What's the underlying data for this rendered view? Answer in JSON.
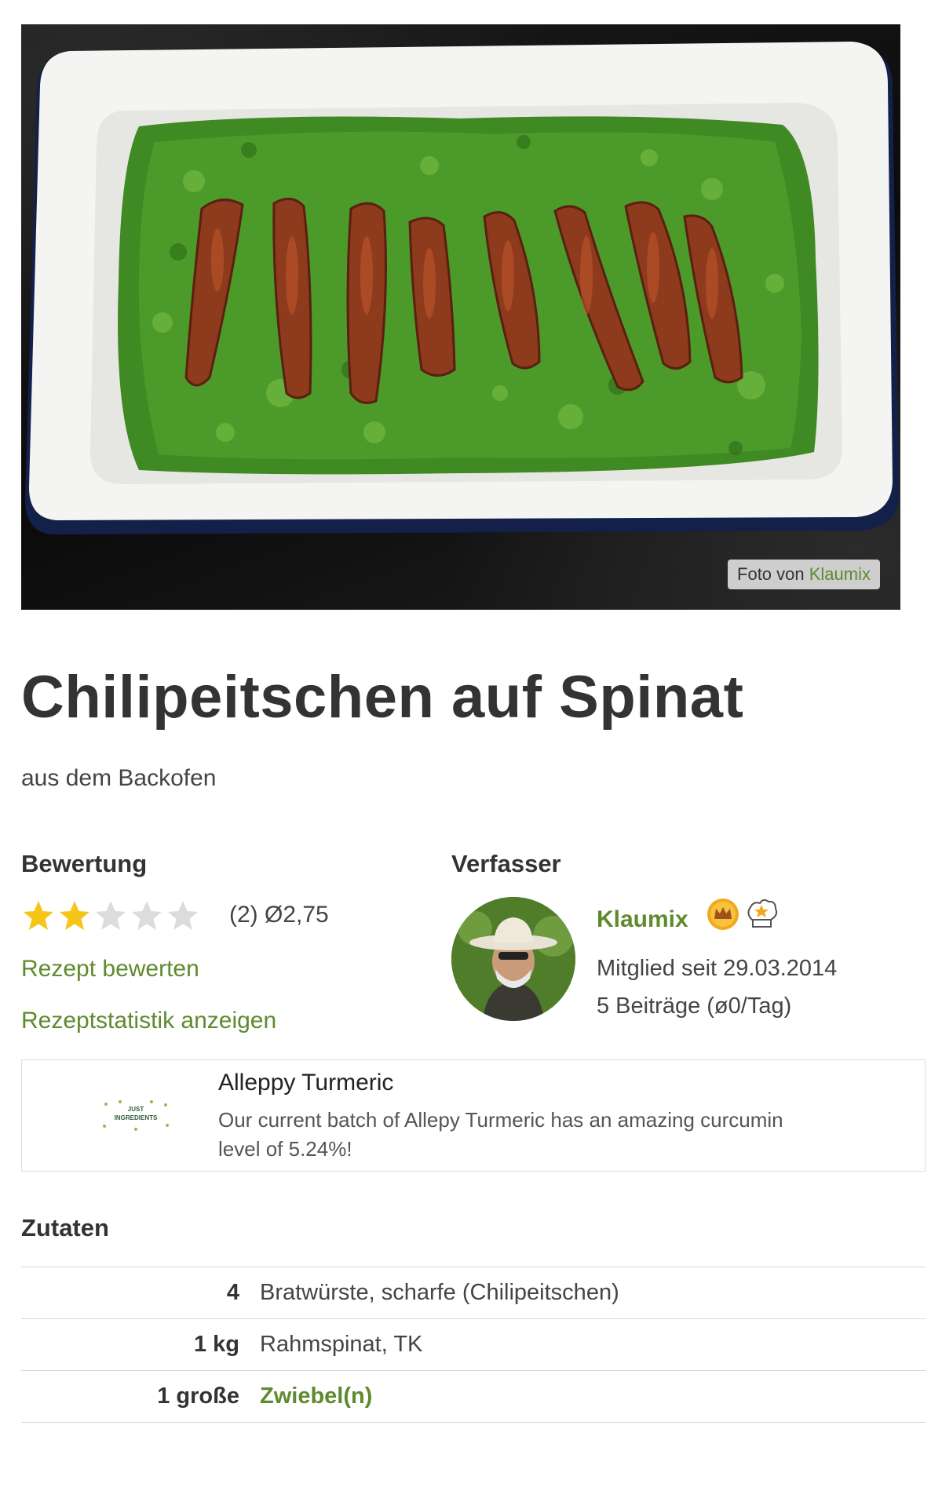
{
  "photo": {
    "credit_prefix": "Foto von",
    "credit_author": "Klaumix"
  },
  "recipe": {
    "title": "Chilipeitschen auf Spinat",
    "subtitle": "aus dem Backofen"
  },
  "rating": {
    "heading": "Bewertung",
    "value": 2.75,
    "max": 5,
    "count_text": "(2) Ø2,75",
    "rate_link": "Rezept bewerten",
    "stats_link": "Rezeptstatistik anzeigen",
    "star_color": "#f5c518",
    "star_empty_color": "#dcdcdc"
  },
  "author": {
    "heading": "Verfasser",
    "name": "Klaumix",
    "member_since": "Mitglied seit 29.03.2014",
    "posts": "5 Beiträge (ø0/Tag)",
    "badges": [
      "crown-icon",
      "chef-hat-icon"
    ]
  },
  "ad": {
    "logo_text_top": "JUST",
    "logo_text_bottom": "INGREDIENTS",
    "title": "Alleppy Turmeric",
    "text": "Our current batch of Allepy Turmeric has an amazing curcumin level of 5.24%!"
  },
  "ingredients": {
    "heading": "Zutaten",
    "rows": [
      {
        "amount": "4",
        "name": "Bratwürste, scharfe (Chilipeitschen)",
        "link": false
      },
      {
        "amount": "1 kg",
        "name": "Rahmspinat, TK",
        "link": false
      },
      {
        "amount": "1 große",
        "name": "Zwiebel(n)",
        "link": true
      }
    ]
  },
  "colors": {
    "accent_green": "#5f8a2e",
    "text": "#333333"
  }
}
